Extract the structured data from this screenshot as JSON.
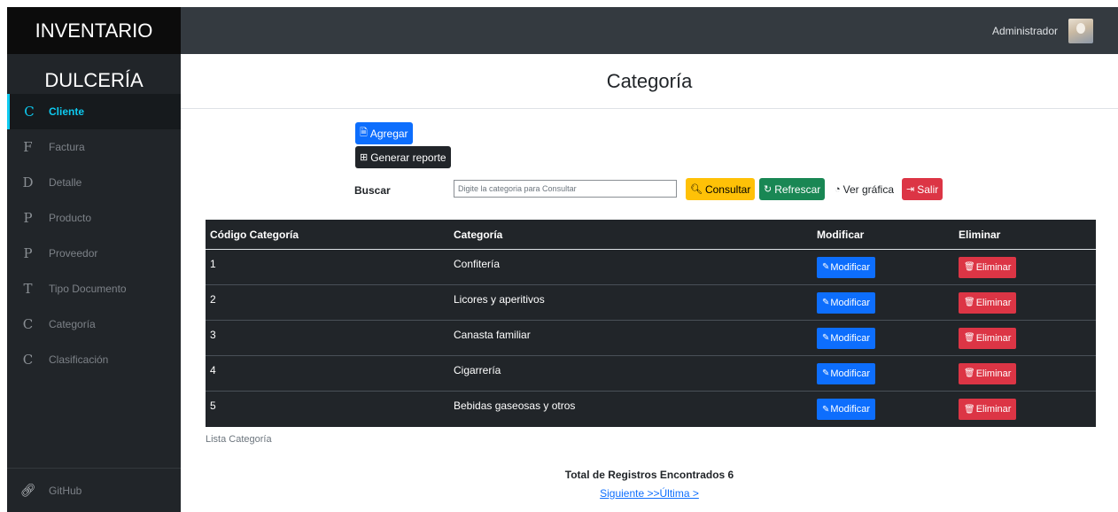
{
  "sidebar": {
    "brand_top": "INVENTARIO",
    "brand_bottom": "DULCERÍA",
    "items": [
      {
        "letter": "C",
        "label": "Cliente"
      },
      {
        "letter": "F",
        "label": "Factura"
      },
      {
        "letter": "D",
        "label": "Detalle"
      },
      {
        "letter": "P",
        "label": "Producto"
      },
      {
        "letter": "P",
        "label": "Proveedor"
      },
      {
        "letter": "T",
        "label": "Tipo Documento"
      },
      {
        "letter": "C",
        "label": "Categoría"
      },
      {
        "letter": "C",
        "label": "Clasificación"
      }
    ],
    "footer": {
      "icon": "link-icon",
      "label": "GitHub"
    }
  },
  "topbar": {
    "user": "Administrador"
  },
  "page": {
    "title": "Categoría"
  },
  "toolbar": {
    "add": "Agregar",
    "report": "Generar reporte",
    "search_label": "Buscar",
    "search_placeholder": "Digite la categoria para Consultar",
    "consult": "Consultar",
    "refresh": "Refrescar",
    "chart": "Ver gráfica",
    "exit": "Salir"
  },
  "table": {
    "headers": [
      "Código Categoría",
      "Categoría",
      "Modificar",
      "Eliminar"
    ],
    "rows": [
      {
        "code": "1",
        "name": "Confitería"
      },
      {
        "code": "2",
        "name": "Licores y aperitivos"
      },
      {
        "code": "3",
        "name": "Canasta familiar"
      },
      {
        "code": "4",
        "name": "Cigarrería"
      },
      {
        "code": "5",
        "name": "Bebidas gaseosas y otros"
      }
    ],
    "modify_label": "Modificar",
    "delete_label": "Eliminar",
    "caption": "Lista Categoría"
  },
  "footer": {
    "total": "Total de Registros Encontrados 6",
    "next": "Siguiente >>",
    "last": "Última >"
  },
  "colors": {
    "primary": "#0d6efd",
    "dark": "#212529",
    "warning": "#ffc107",
    "success": "#198754",
    "danger": "#dc3545",
    "active_nav": "#0dcaf0"
  }
}
